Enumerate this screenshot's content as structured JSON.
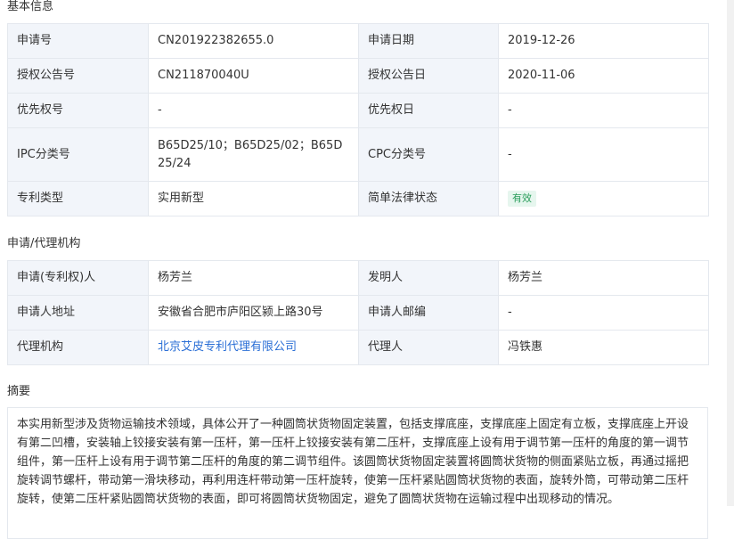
{
  "sections": {
    "basic_info": "基本信息",
    "applicant_agency": "申请/代理机构",
    "abstract": "摘要"
  },
  "basic": {
    "rows": [
      {
        "label1": "申请号",
        "value1": "CN201922382655.0",
        "label2": "申请日期",
        "value2": "2019-12-26"
      },
      {
        "label1": "授权公告号",
        "value1": "CN211870040U",
        "label2": "授权公告日",
        "value2": "2020-11-06"
      },
      {
        "label1": "优先权号",
        "value1": "-",
        "label2": "优先权日",
        "value2": "-"
      },
      {
        "label1": "IPC分类号",
        "value1": "B65D25/10；B65D25/02；B65D25/24",
        "label2": "CPC分类号",
        "value2": "-"
      },
      {
        "label1": "专利类型",
        "value1": "实用新型",
        "label2": "简单法律状态",
        "value2": "有效"
      }
    ]
  },
  "applicant": {
    "rows": [
      {
        "label1": "申请(专利权)人",
        "value1": "杨芳兰",
        "label2": "发明人",
        "value2": "杨芳兰"
      },
      {
        "label1": "申请人地址",
        "value1": "安徽省合肥市庐阳区颍上路30号",
        "label2": "申请人邮编",
        "value2": "-"
      },
      {
        "label1": "代理机构",
        "value1": "北京艾皮专利代理有限公司",
        "label2": "代理人",
        "value2": "冯铁惠"
      }
    ]
  },
  "abstract_text": "本实用新型涉及货物运输技术领域，具体公开了一种圆筒状货物固定装置，包括支撑底座，支撑底座上固定有立板，支撑底座上开设有第二凹槽，安装轴上铰接安装有第一压杆，第一压杆上铰接安装有第二压杆，支撑底座上设有用于调节第一压杆的角度的第一调节组件，第一压杆上设有用于调节第二压杆的角度的第二调节组件。该圆筒状货物固定装置将圆筒状货物的侧面紧贴立板，再通过摇把旋转调节螺杆，带动第一滑块移动，再利用连杆带动第一压杆旋转，使第一压杆紧贴圆筒状货物的表面，旋转外筒，可带动第二压杆旋转，使第二压杆紧贴圆筒状货物的表面，即可将圆筒状货物固定，避免了圆筒状货物在运输过程中出现移动的情况。"
}
